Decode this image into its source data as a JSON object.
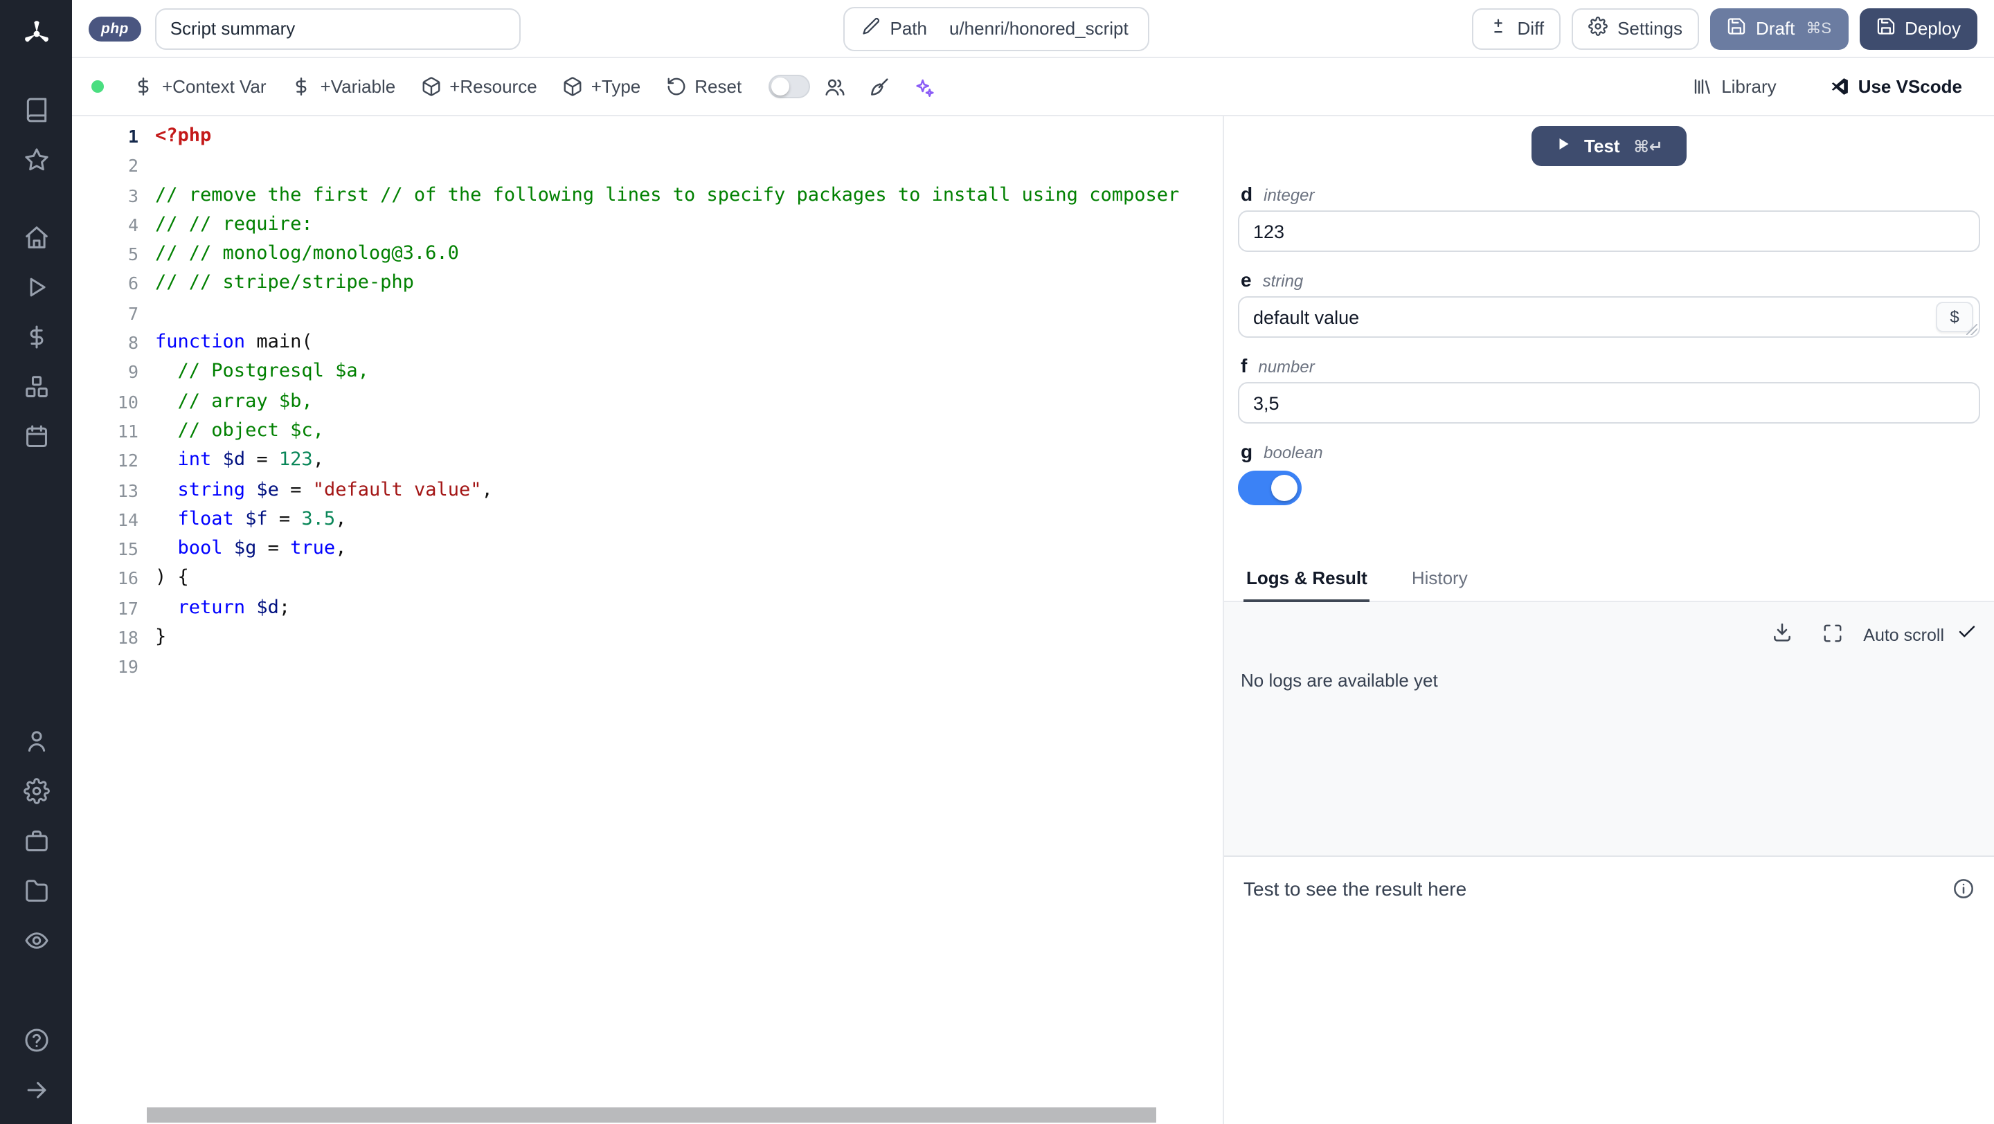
{
  "colors": {
    "accent": "#3b82f6",
    "deploy": "#3e4c6e",
    "draft": "#6b7ca1",
    "sidebar_bg": "#1e232d",
    "green_dot": "#4ade80",
    "sparkles": "#8b5cf6"
  },
  "sidebar": {
    "groups": [
      {
        "items": [
          "windmill-logo"
        ]
      },
      {
        "items": [
          "notebook",
          "star"
        ]
      },
      {
        "items": [
          "home",
          "play",
          "dollar",
          "boxes",
          "calendar"
        ]
      },
      {
        "items": [
          "user",
          "settings",
          "toolbox",
          "folder",
          "eye"
        ]
      },
      {
        "items": [
          "help",
          "arrow-right"
        ]
      }
    ]
  },
  "topbar": {
    "language": "php",
    "summary_value": "Script summary",
    "path_label": "Path",
    "path_value": "u/henri/honored_script",
    "diff_label": "Diff",
    "settings_label": "Settings",
    "draft_label": "Draft",
    "draft_shortcut": "⌘S",
    "deploy_label": "Deploy"
  },
  "toolbar": {
    "actions": [
      {
        "icon": "dollar",
        "label": "+Context Var",
        "name": "add-context-var-button"
      },
      {
        "icon": "dollar",
        "label": "+Variable",
        "name": "add-variable-button"
      },
      {
        "icon": "package",
        "label": "+Resource",
        "name": "add-resource-button"
      },
      {
        "icon": "package",
        "label": "+Type",
        "name": "add-type-button"
      },
      {
        "icon": "reset",
        "label": "Reset",
        "name": "reset-button"
      }
    ],
    "icon_controls": [
      {
        "icon": "users",
        "name": "multiplayer-users-button"
      },
      {
        "icon": "brush",
        "name": "format-code-button"
      },
      {
        "icon": "sparkles",
        "name": "ai-assistant-button"
      }
    ],
    "right": [
      {
        "icon": "library",
        "label": "Library",
        "name": "library-button",
        "strong": false
      },
      {
        "icon": "vscode",
        "label": "Use VScode",
        "name": "use-vscode-button",
        "strong": true
      }
    ]
  },
  "editor": {
    "language": "php",
    "lines": [
      [
        [
          "meta",
          "<?php"
        ]
      ],
      [],
      [
        [
          "comment",
          "// remove the first // of the following lines to specify packages to install using composer"
        ]
      ],
      [
        [
          "comment",
          "// // require:"
        ]
      ],
      [
        [
          "comment",
          "// // monolog/monolog@3.6.0"
        ]
      ],
      [
        [
          "comment",
          "// // stripe/stripe-php"
        ]
      ],
      [],
      [
        [
          "keyword",
          "function"
        ],
        [
          "plain",
          " main("
        ]
      ],
      [
        [
          "plain",
          "  "
        ],
        [
          "comment",
          "// Postgresql $a,"
        ]
      ],
      [
        [
          "plain",
          "  "
        ],
        [
          "comment",
          "// array $b,"
        ]
      ],
      [
        [
          "plain",
          "  "
        ],
        [
          "comment",
          "// object $c,"
        ]
      ],
      [
        [
          "plain",
          "  "
        ],
        [
          "keyword",
          "int"
        ],
        [
          "plain",
          " "
        ],
        [
          "var",
          "$d"
        ],
        [
          "plain",
          " = "
        ],
        [
          "num",
          "123"
        ],
        [
          "plain",
          ","
        ]
      ],
      [
        [
          "plain",
          "  "
        ],
        [
          "keyword",
          "string"
        ],
        [
          "plain",
          " "
        ],
        [
          "var",
          "$e"
        ],
        [
          "plain",
          " = "
        ],
        [
          "str",
          "\"default value\""
        ],
        [
          "plain",
          ","
        ]
      ],
      [
        [
          "plain",
          "  "
        ],
        [
          "keyword",
          "float"
        ],
        [
          "plain",
          " "
        ],
        [
          "var",
          "$f"
        ],
        [
          "plain",
          " = "
        ],
        [
          "num",
          "3.5"
        ],
        [
          "plain",
          ","
        ]
      ],
      [
        [
          "plain",
          "  "
        ],
        [
          "keyword",
          "bool"
        ],
        [
          "plain",
          " "
        ],
        [
          "var",
          "$g"
        ],
        [
          "plain",
          " = "
        ],
        [
          "keyword",
          "true"
        ],
        [
          "plain",
          ","
        ]
      ],
      [
        [
          "plain",
          ") {"
        ]
      ],
      [
        [
          "plain",
          "  "
        ],
        [
          "keyword",
          "return"
        ],
        [
          "plain",
          " "
        ],
        [
          "var",
          "$d"
        ],
        [
          "plain",
          ";"
        ]
      ],
      [
        [
          "plain",
          "}"
        ]
      ],
      []
    ]
  },
  "args": {
    "test_label": "Test",
    "test_shortcut": "⌘↵",
    "fields": [
      {
        "name": "d",
        "type": "integer",
        "value": "123",
        "control": "input"
      },
      {
        "name": "e",
        "type": "string",
        "value": "default value",
        "control": "textarea",
        "suffix": "$"
      },
      {
        "name": "f",
        "type": "number",
        "value": "3,5",
        "control": "input"
      },
      {
        "name": "g",
        "type": "boolean",
        "value": true,
        "control": "toggle"
      }
    ]
  },
  "results": {
    "tabs": [
      {
        "label": "Logs & Result",
        "active": true
      },
      {
        "label": "History",
        "active": false
      }
    ],
    "auto_scroll_label": "Auto scroll",
    "empty_logs": "No logs are available yet",
    "placeholder": "Test to see the result here"
  }
}
